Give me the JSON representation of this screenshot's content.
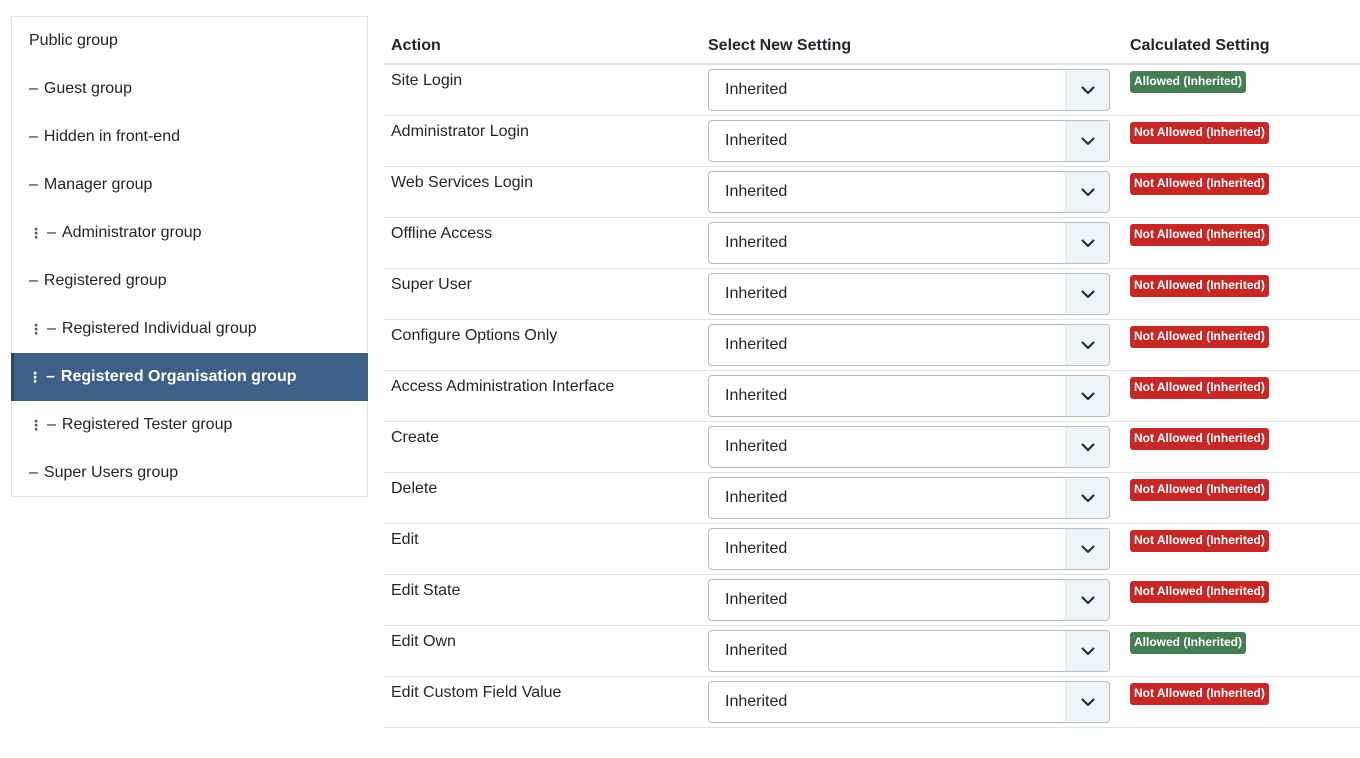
{
  "groups": [
    {
      "label": "Public group",
      "prefix": "",
      "drag": false,
      "active": false
    },
    {
      "label": "Guest group",
      "prefix": "–",
      "drag": false,
      "active": false
    },
    {
      "label": "Hidden in front-end",
      "prefix": "–",
      "drag": false,
      "active": false
    },
    {
      "label": "Manager group",
      "prefix": "–",
      "drag": false,
      "active": false
    },
    {
      "label": "Administrator group",
      "prefix": "–",
      "drag": true,
      "active": false
    },
    {
      "label": "Registered group",
      "prefix": "–",
      "drag": false,
      "active": false
    },
    {
      "label": "Registered Individual group",
      "prefix": "–",
      "drag": true,
      "active": false
    },
    {
      "label": "Registered Organisation group",
      "prefix": "–",
      "drag": true,
      "active": true
    },
    {
      "label": "Registered Tester group",
      "prefix": "–",
      "drag": true,
      "active": false
    },
    {
      "label": "Super Users group",
      "prefix": "–",
      "drag": false,
      "active": false
    }
  ],
  "table": {
    "headers": {
      "action": "Action",
      "select": "Select New Setting",
      "calculated": "Calculated Setting"
    },
    "rows": [
      {
        "action": "Site Login",
        "setting": "Inherited",
        "calculated": "Allowed (Inherited)",
        "status": "allowed"
      },
      {
        "action": "Administrator Login",
        "setting": "Inherited",
        "calculated": "Not Allowed (Inherited)",
        "status": "denied"
      },
      {
        "action": "Web Services Login",
        "setting": "Inherited",
        "calculated": "Not Allowed (Inherited)",
        "status": "denied"
      },
      {
        "action": "Offline Access",
        "setting": "Inherited",
        "calculated": "Not Allowed (Inherited)",
        "status": "denied"
      },
      {
        "action": "Super User",
        "setting": "Inherited",
        "calculated": "Not Allowed (Inherited)",
        "status": "denied"
      },
      {
        "action": "Configure Options Only",
        "setting": "Inherited",
        "calculated": "Not Allowed (Inherited)",
        "status": "denied"
      },
      {
        "action": "Access Administration Interface",
        "setting": "Inherited",
        "calculated": "Not Allowed (Inherited)",
        "status": "denied"
      },
      {
        "action": "Create",
        "setting": "Inherited",
        "calculated": "Not Allowed (Inherited)",
        "status": "denied"
      },
      {
        "action": "Delete",
        "setting": "Inherited",
        "calculated": "Not Allowed (Inherited)",
        "status": "denied"
      },
      {
        "action": "Edit",
        "setting": "Inherited",
        "calculated": "Not Allowed (Inherited)",
        "status": "denied"
      },
      {
        "action": "Edit State",
        "setting": "Inherited",
        "calculated": "Not Allowed (Inherited)",
        "status": "denied"
      },
      {
        "action": "Edit Own",
        "setting": "Inherited",
        "calculated": "Allowed (Inherited)",
        "status": "allowed"
      },
      {
        "action": "Edit Custom Field Value",
        "setting": "Inherited",
        "calculated": "Not Allowed (Inherited)",
        "status": "denied"
      }
    ]
  },
  "icons": {
    "select_caret": "chevron-down-icon",
    "drag_handle": "drag-handle-icon"
  },
  "colors": {
    "active_group": "#3e5f86",
    "allowed": "#457d54",
    "denied": "#c52827"
  }
}
